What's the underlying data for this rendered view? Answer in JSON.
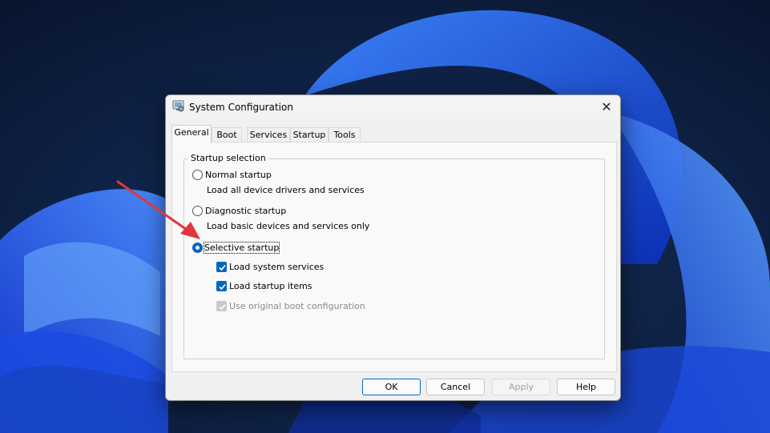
{
  "window": {
    "title": "System Configuration",
    "close_glyph": "✕"
  },
  "tabs": [
    {
      "label": "General",
      "selected": true
    },
    {
      "label": "Boot",
      "selected": false
    },
    {
      "label": "Services",
      "selected": false
    },
    {
      "label": "Startup",
      "selected": false
    },
    {
      "label": "Tools",
      "selected": false
    }
  ],
  "startup_selection": {
    "group_label": "Startup selection",
    "options": [
      {
        "label": "Normal startup",
        "description": "Load all device drivers and services",
        "selected": false
      },
      {
        "label": "Diagnostic startup",
        "description": "Load basic devices and services only",
        "selected": false
      },
      {
        "label": "Selective startup",
        "selected": true
      }
    ],
    "selective_items": [
      {
        "label": "Load system services",
        "checked": true,
        "enabled": true
      },
      {
        "label": "Load startup items",
        "checked": true,
        "enabled": true
      },
      {
        "label": "Use original boot configuration",
        "checked": true,
        "enabled": false
      }
    ]
  },
  "buttons": {
    "ok": "OK",
    "cancel": "Cancel",
    "apply": "Apply",
    "help": "Help"
  },
  "colors": {
    "accent": "#0067c0",
    "arrow": "#e0363c",
    "wallpaper_dark": "#0a1a3a",
    "wallpaper_bloom": "#2f6bff"
  }
}
